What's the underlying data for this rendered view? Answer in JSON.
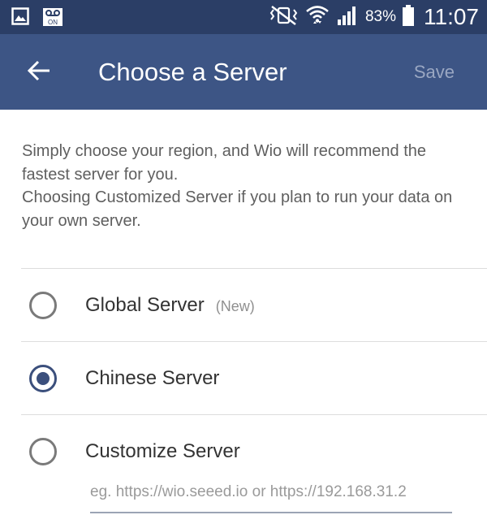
{
  "status_bar": {
    "icons": [
      "image-icon",
      "voicemail-icon",
      "vibrate-icon",
      "wifi-icon",
      "signal-icon",
      "battery-icon"
    ],
    "voicemail_label": "ON",
    "battery": "83%",
    "time": "11:07"
  },
  "app_bar": {
    "back_icon": "arrow-left-icon",
    "title": "Choose a Server",
    "save_label": "Save"
  },
  "description": "Simply choose your region, and Wio will recommend the fastest server for you.\n Choosing Customized Server if you plan to run your data on your own server.",
  "options": [
    {
      "label": "Global Server",
      "badge": "(New)",
      "selected": false
    },
    {
      "label": "Chinese Server",
      "badge": "",
      "selected": true
    },
    {
      "label": "Customize Server",
      "badge": "",
      "selected": false
    }
  ],
  "custom_server": {
    "value": "",
    "placeholder": "eg. https://wio.seeed.io or https://192.168.31.2"
  },
  "colors": {
    "status_bar": "#2b3e66",
    "app_bar": "#3d5585",
    "accent": "#3b4f7c",
    "save_disabled": "#9aa7c2"
  }
}
